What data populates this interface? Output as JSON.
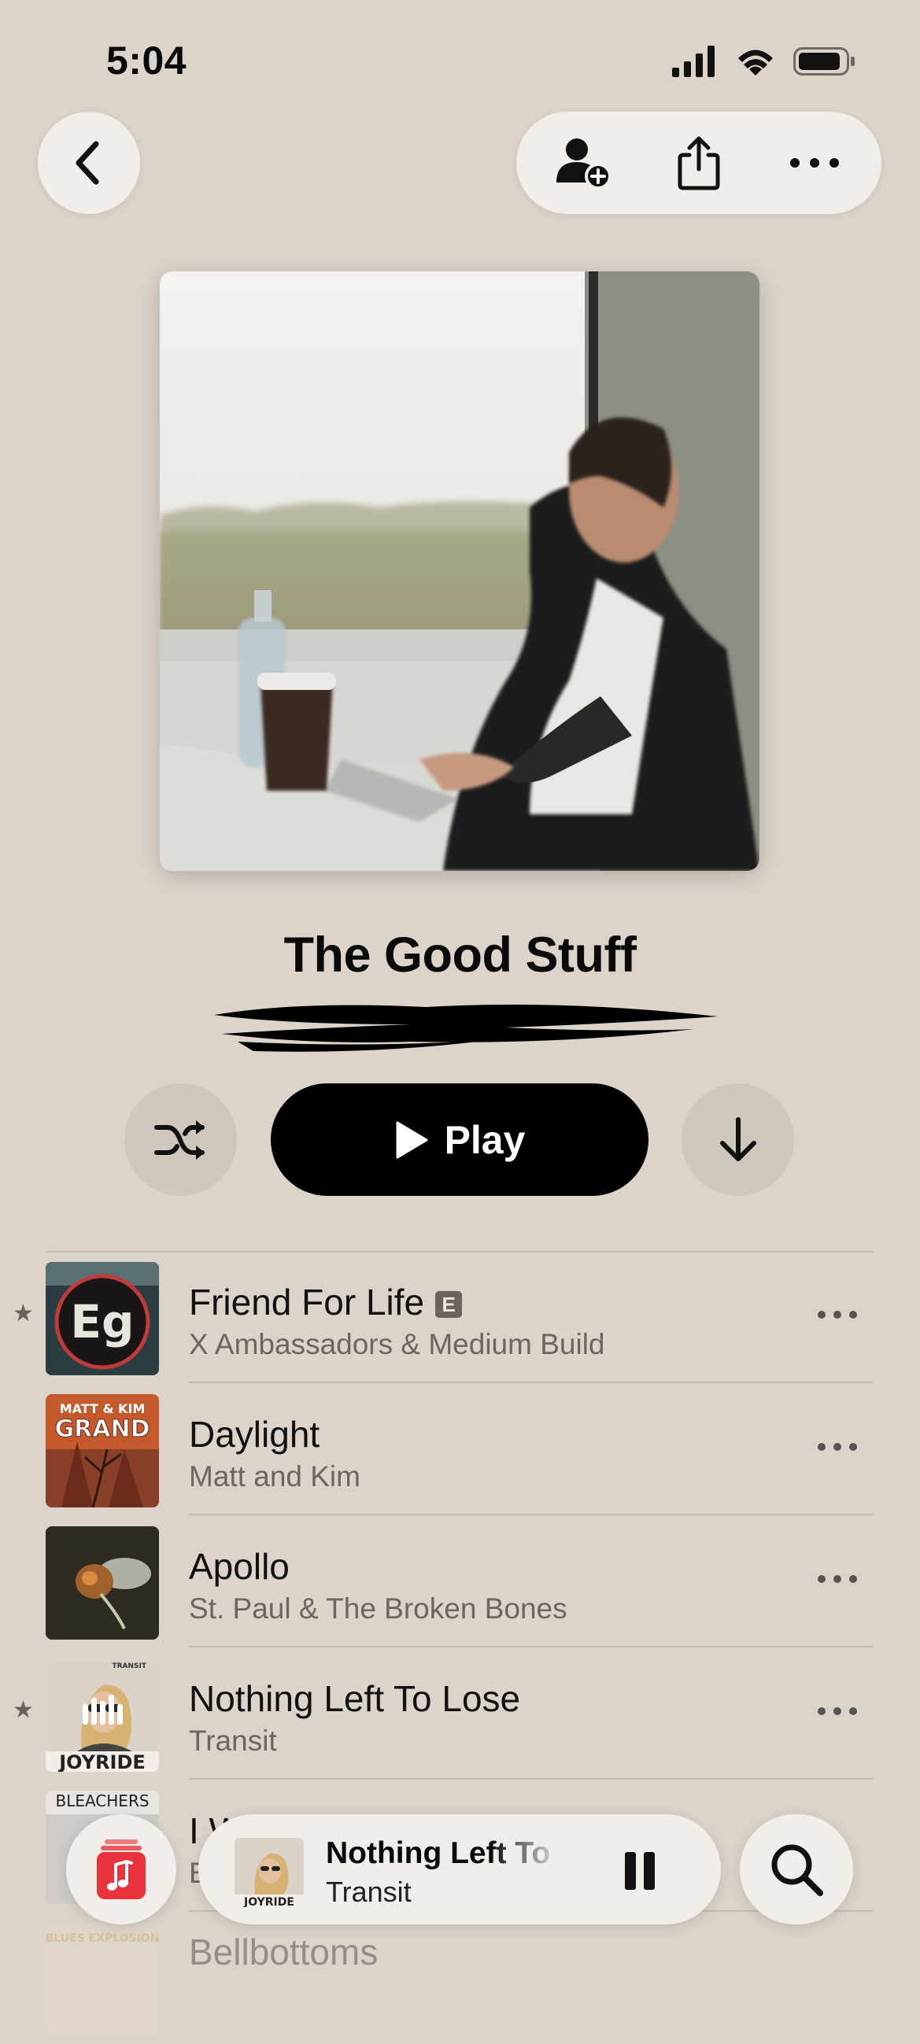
{
  "status_bar": {
    "time": "5:04"
  },
  "playlist": {
    "title": "The Good Stuff",
    "play_label": "Play"
  },
  "tracks": [
    {
      "title": "Friend For Life",
      "artist": "X Ambassadors & Medium Build",
      "explicit": "E",
      "starred": true
    },
    {
      "title": "Daylight",
      "artist": "Matt and Kim",
      "starred": false
    },
    {
      "title": "Apollo",
      "artist": "St. Paul & The Broken Bones",
      "starred": false
    },
    {
      "title": "Nothing Left To Lose",
      "artist": "Transit",
      "starred": true
    },
    {
      "title": "I W",
      "artist": "E",
      "starred": false
    },
    {
      "title": "Bellbottoms",
      "artist": "",
      "starred": false
    }
  ],
  "thumb_text": {
    "track1": "Eg",
    "track2_line1": "MATT & KIM",
    "track2_line2": "GRAND",
    "track4": "JOYRIDE",
    "track4_top": "TRANSIT",
    "track5": "BLEACHERS",
    "track6": "BLUES EXPLOSION"
  },
  "now_playing": {
    "title": "Nothing Left To Lose",
    "artist": "Transit",
    "thumb_text": "JOYRIDE"
  },
  "star_glyph": "★",
  "colors": {
    "background": "#dcd3ca",
    "accent": "#e8323c",
    "play_button": "#000000"
  }
}
